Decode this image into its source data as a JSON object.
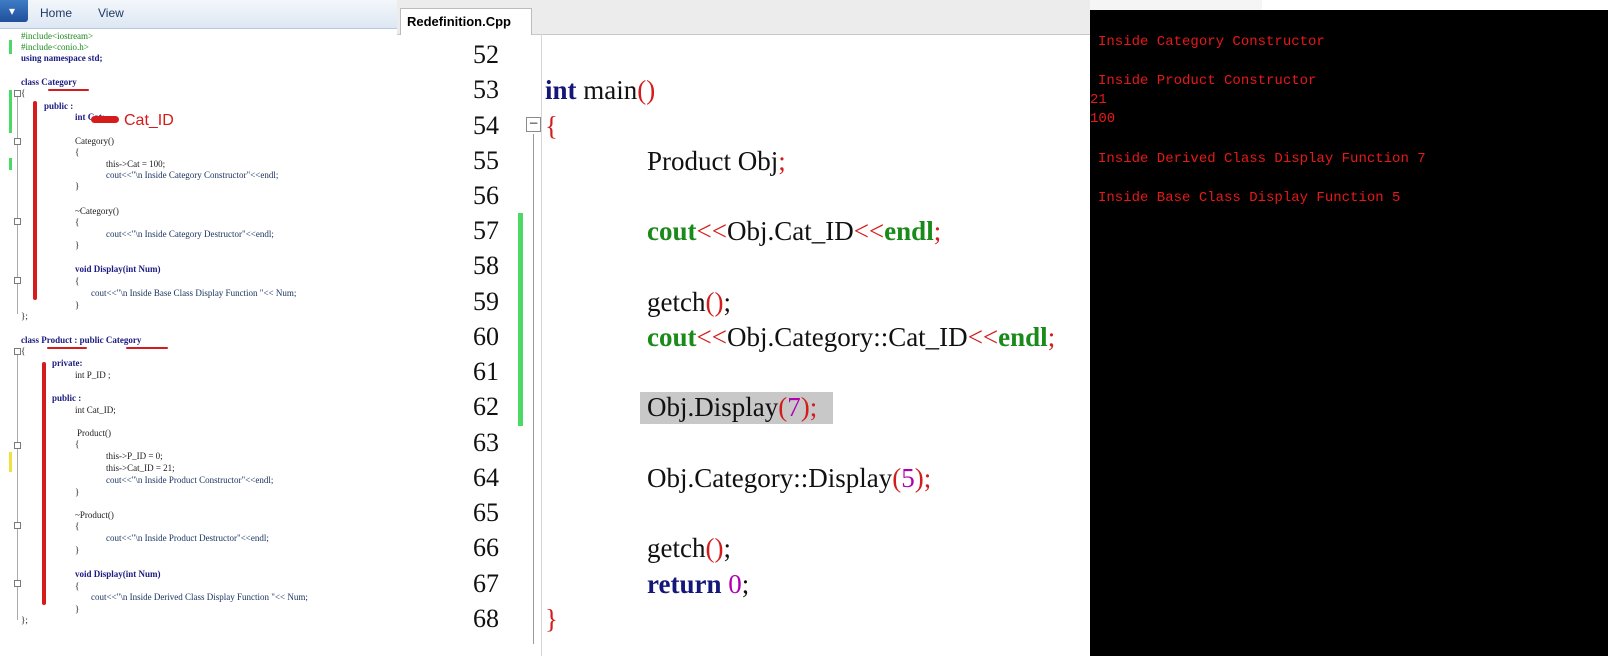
{
  "ribbon": {
    "tabs": [
      "Home",
      "View"
    ]
  },
  "left_code": {
    "lines": [
      "#include<iostream>",
      "#include<conio.h>",
      "using namespace std;",
      "class Category",
      "{",
      "public :",
      "int Cat;",
      "Category()",
      "{",
      "this->Cat = 100;",
      "cout<<\"\\n Inside Category Constructor\"<<endl;",
      "}",
      "~Category()",
      "{",
      "cout<<\"\\n Inside Category Destructor\"<<endl;",
      "}",
      "void Display(int Num)",
      "{",
      "cout<<\"\\n Inside Base Class Display Function \"<< Num;",
      "}",
      "};",
      "class Product : public Category",
      "{",
      "private:",
      "int P_ID ;",
      "public :",
      "int Cat_ID;",
      "Product()",
      "{",
      "this->P_ID = 0;",
      "this->Cat_ID = 21;",
      "cout<<\"\\n Inside Product Constructor\"<<endl;",
      "}",
      "~Product()",
      "{",
      "cout<<\"\\n Inside Product Destructor\"<<endl;",
      "}",
      "void Display(int Num)",
      "{",
      "cout<<\"\\n Inside Derived Class Display Function \"<< Num;",
      "}",
      "};"
    ],
    "annotation": "Cat_ID"
  },
  "editor": {
    "tab_title": "Redefinition.Cpp",
    "line_numbers": [
      "52",
      "53",
      "54",
      "55",
      "56",
      "57",
      "58",
      "59",
      "60",
      "61",
      "62",
      "63",
      "64",
      "65",
      "66",
      "67",
      "68"
    ],
    "code": {
      "l53_kw": "int",
      "l53_rest": " main",
      "l53_par": "()",
      "l54": "{",
      "l55a": "Product Obj",
      "l55b": ";",
      "l57_cout": "cout",
      "l57_op1": "<<",
      "l57_mid": "Obj.Cat_ID",
      "l57_op2": "<<",
      "l57_endl": "endl",
      "l57_semi": ";",
      "l59a": "getch",
      "l59b": "()",
      "l59c": ";",
      "l60_cout": "cout",
      "l60_op1": "<<",
      "l60_mid": "Obj.Category::Cat_ID",
      "l60_op2": "<<",
      "l60_endl": "endl",
      "l60_semi": ";",
      "l62a": "Obj.Display",
      "l62b": "(",
      "l62c": "7",
      "l62d": ")",
      "l62e": ";",
      "l64a": "Obj.Category::Display",
      "l64b": "(",
      "l64c": "5",
      "l64d": ")",
      "l64e": ";",
      "l66a": "getch",
      "l66b": "()",
      "l66c": ";",
      "l67_kw": "return",
      "l67_num": "0",
      "l67_semi": ";",
      "l68": "}"
    }
  },
  "console": {
    "lines": [
      "Inside Category Constructor",
      "Inside Product Constructor",
      "21",
      "100",
      "Inside Derived Class Display Function 7",
      "Inside Base Class Display Function 5"
    ]
  },
  "colors": {
    "keyword": "#14167a",
    "cout": "#1a8a1a",
    "paren": "#d41c1c",
    "number": "#b000b0",
    "console_text": "#e81818",
    "change_bar": "#4cd964"
  }
}
